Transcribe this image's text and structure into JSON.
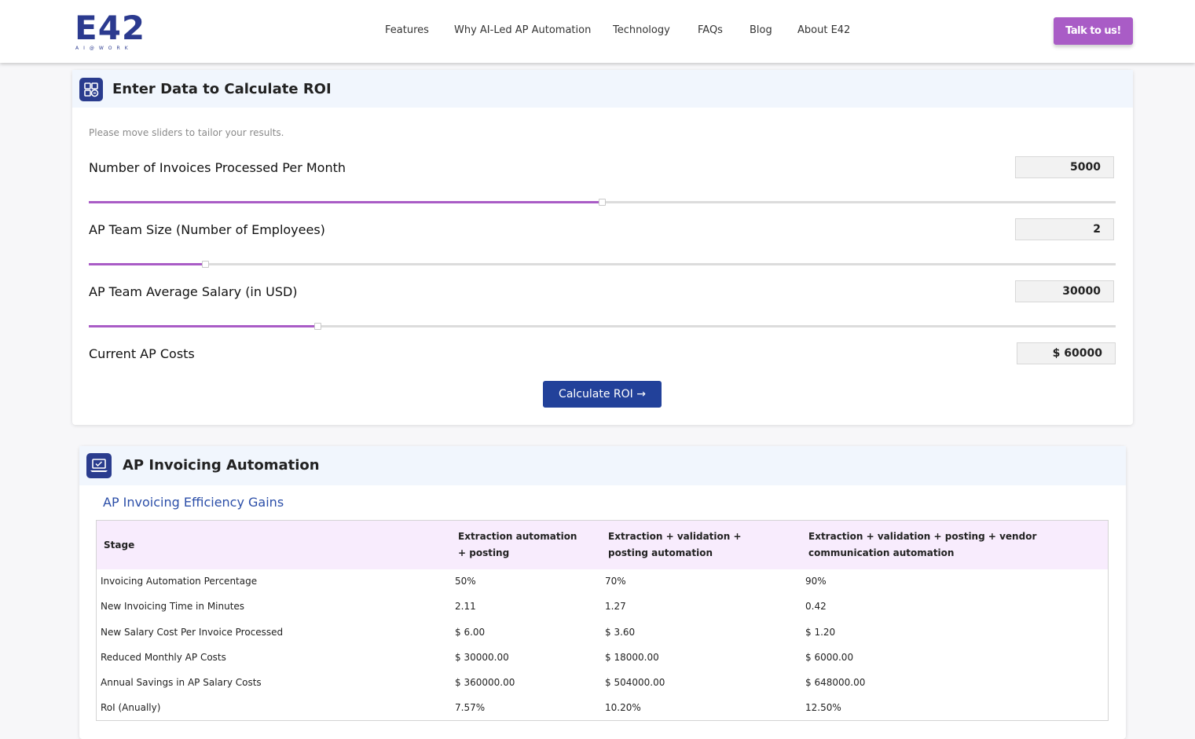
{
  "header": {
    "logo_main": "E42",
    "logo_sub": "AI@WORK",
    "nav": [
      "Features",
      "Why AI-Led AP Automation",
      "Technology",
      "FAQs",
      "Blog",
      "About E42"
    ],
    "cta": "Talk to us!"
  },
  "roi_card": {
    "title": "Enter Data to Calculate ROI",
    "hint": "Please move sliders to tailor your results.",
    "fields": [
      {
        "label": "Number of Invoices Processed Per Month",
        "value": "5000",
        "slider_level": 0.5
      },
      {
        "label": "AP Team Size (Number of Employees)",
        "value": "2",
        "slider_level": 0.113
      },
      {
        "label": "AP Team Average Salary (in USD)",
        "value": "30000",
        "slider_level": 0.22
      }
    ],
    "current_costs": {
      "label": "Current AP Costs",
      "value": "$ 60000"
    },
    "button": "Calculate ROI →"
  },
  "automation_card": {
    "title": "AP Invoicing Automation",
    "subtitle": "AP Invoicing Efficiency Gains",
    "table": {
      "headers": [
        "Stage",
        "Extraction automation + posting",
        "Extraction + validation + posting automation",
        "Extraction + validation + posting + vendor communication automation"
      ],
      "rows": [
        [
          "Invoicing Automation Percentage",
          "50%",
          "70%",
          "90%"
        ],
        [
          "New Invoicing Time in Minutes",
          "2.11",
          "1.27",
          "0.42"
        ],
        [
          "New Salary Cost Per Invoice Processed",
          "$ 6.00",
          "$ 3.60",
          "$ 1.20"
        ],
        [
          "Reduced Monthly AP Costs",
          "$ 30000.00",
          "$ 18000.00",
          "$ 6000.00"
        ],
        [
          "Annual Savings in AP Salary Costs",
          "$ 360000.00",
          "$ 504000.00",
          "$ 648000.00"
        ],
        [
          "RoI (Anually)",
          "7.57%",
          "10.20%",
          "12.50%"
        ]
      ]
    }
  },
  "colors": {
    "brand": "#2b3a8f",
    "accent": "#a95cc6",
    "button": "#22419a"
  }
}
